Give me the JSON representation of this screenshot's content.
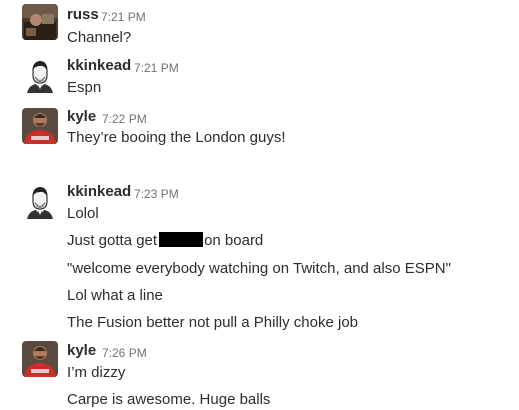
{
  "messages": [
    {
      "user": "russ",
      "time": "7:21 PM",
      "avatar": "photo-avatar",
      "lines": [
        "Channel?"
      ]
    },
    {
      "user": "kkinkead",
      "time": "7:21 PM",
      "avatar": "sketch-portrait-avatar",
      "lines": [
        "Espn"
      ]
    },
    {
      "user": "kyle",
      "time": "7:22 PM",
      "avatar": "red-shirt-photo-avatar",
      "lines": [
        "They’re booing the London guys!"
      ]
    },
    {
      "user": "kkinkead",
      "time": "7:23 PM",
      "avatar": "sketch-portrait-avatar",
      "lines": [
        "Lolol",
        "Just gotta get",
        "on board",
        "\"welcome everybody watching on Twitch, and also ESPN\"",
        "Lol what a line",
        "The Fusion better not pull a Philly choke job"
      ]
    },
    {
      "user": "kyle",
      "time": "7:26 PM",
      "avatar": "red-shirt-photo-avatar",
      "lines": [
        "I’m dizzy",
        "Carpe is awesome. Huge balls"
      ]
    }
  ],
  "colors": {
    "text": "#2c2d30",
    "timestamp": "#717274",
    "redaction": "#000000",
    "jersey_red": "#c8302c"
  }
}
